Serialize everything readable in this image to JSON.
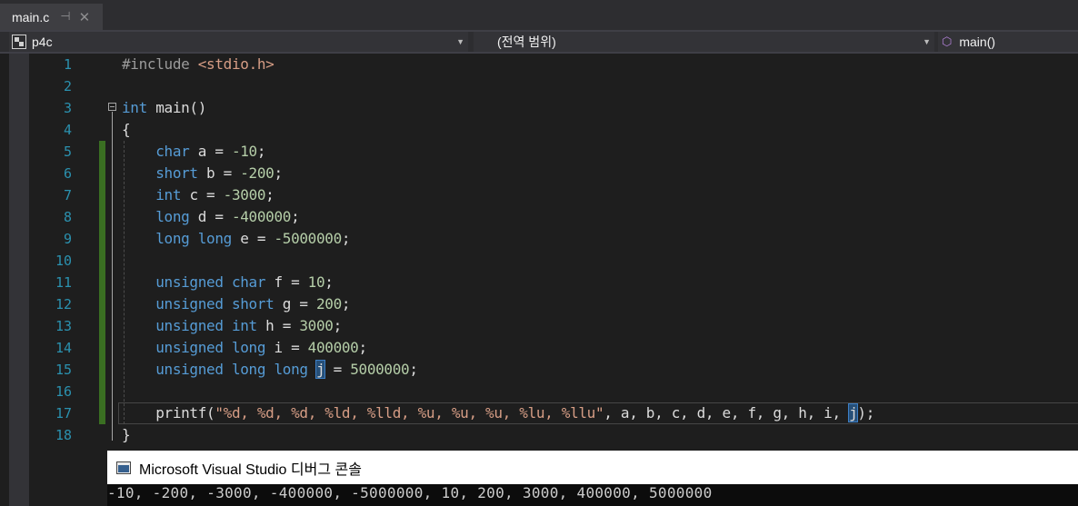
{
  "tab": {
    "title": "main.c",
    "pin_glyph": "⊣",
    "close_glyph": "✕"
  },
  "nav": {
    "project": "p4c",
    "scope": "(전역 범위)",
    "member": "main()"
  },
  "editor": {
    "line_numbers": [
      "1",
      "2",
      "3",
      "4",
      "5",
      "6",
      "7",
      "8",
      "9",
      "10",
      "11",
      "12",
      "13",
      "14",
      "15",
      "16",
      "17",
      "18"
    ],
    "code": {
      "l1_directive": "#include",
      "l1_header": "<stdio.h>",
      "l3_type": "int",
      "l3_name": " main()",
      "l4": "{",
      "l5": [
        "char",
        " a = ",
        "-10",
        ";"
      ],
      "l6": [
        "short",
        " b = ",
        "-200",
        ";"
      ],
      "l7": [
        "int",
        " c = ",
        "-3000",
        ";"
      ],
      "l8": [
        "long",
        " d = ",
        "-400000",
        ";"
      ],
      "l9": [
        "long long",
        " e = ",
        "-5000000",
        ";"
      ],
      "l11": [
        "unsigned char",
        " f = ",
        "10",
        ";"
      ],
      "l12": [
        "unsigned short",
        " g = ",
        "200",
        ";"
      ],
      "l13": [
        "unsigned int",
        " h = ",
        "3000",
        ";"
      ],
      "l14": [
        "unsigned long",
        " i = ",
        "400000",
        ";"
      ],
      "l15": [
        "unsigned long long",
        " ",
        "j",
        " = ",
        "5000000",
        ";"
      ],
      "l17": [
        "printf",
        "(",
        "\"%d, %d, %d, %ld, %lld, %u, %u, %u, %lu, %llu\"",
        ", a, b, c, d, e, f, g, h, i, ",
        "j",
        ");"
      ],
      "l18": "}"
    }
  },
  "console": {
    "title": "Microsoft Visual Studio 디버그 콘솔",
    "output": "-10, -200, -3000, -400000, -5000000, 10, 200, 3000, 400000, 5000000"
  },
  "colors": {
    "keyword": "#569cd6",
    "number": "#b5cea8",
    "string": "#d69d85",
    "line_number": "#2b91af",
    "change_bar": "#3a6f22"
  }
}
